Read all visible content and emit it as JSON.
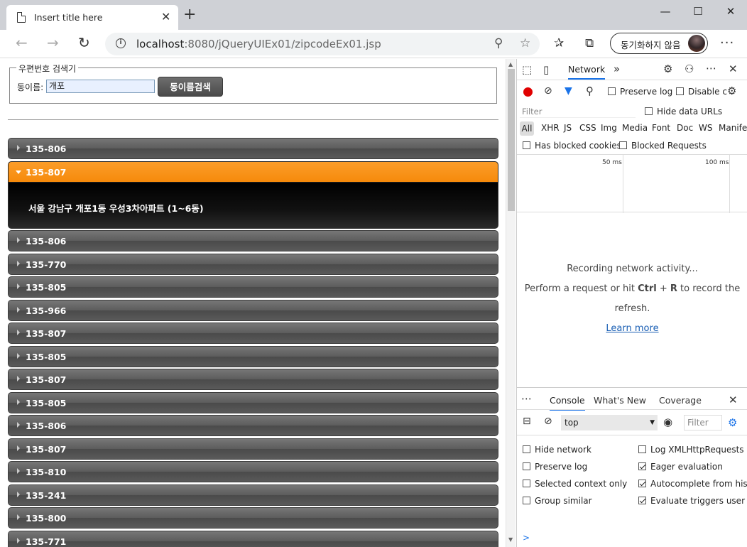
{
  "browser": {
    "tab_title": "Insert title here",
    "new_tab_symbol": "+",
    "url_host": "localhost",
    "url_path": ":8080/jQueryUIEx01/zipcodeEx01.jsp",
    "sync_label": "동기화하지 않음"
  },
  "form": {
    "legend": "우편번호 검색기",
    "dong_label": "동이름:",
    "dong_value": "개포",
    "search_button": "동이름검색"
  },
  "accordion": {
    "items": [
      {
        "code": "135-806"
      },
      {
        "code": "135-807",
        "content": "서울 강남구 개포1동 우성3차아파트 (1~6동)"
      },
      {
        "code": "135-806"
      },
      {
        "code": "135-770"
      },
      {
        "code": "135-805"
      },
      {
        "code": "135-966"
      },
      {
        "code": "135-807"
      },
      {
        "code": "135-805"
      },
      {
        "code": "135-807"
      },
      {
        "code": "135-805"
      },
      {
        "code": "135-806"
      },
      {
        "code": "135-807"
      },
      {
        "code": "135-810"
      },
      {
        "code": "135-241"
      },
      {
        "code": "135-800"
      },
      {
        "code": "135-771"
      }
    ]
  },
  "devtools": {
    "network_tab": "Network",
    "more_tabs": "»",
    "preserve_log": "Preserve log",
    "disable_cache": "Disable c",
    "filter_placeholder": "Filter",
    "hide_data_urls": "Hide data URLs",
    "types": [
      "All",
      "XHR",
      "JS",
      "CSS",
      "Img",
      "Media",
      "Font",
      "Doc",
      "WS",
      "Manifes"
    ],
    "has_blocked_cookies": "Has blocked cookies",
    "blocked_requests": "Blocked Requests",
    "timeline_labels": [
      "50 ms",
      "100 ms"
    ],
    "msg_recording": "Recording network activity...",
    "msg_perform_pre": "Perform a request or hit ",
    "msg_ctrl": "Ctrl",
    "msg_plus": " + ",
    "msg_r": "R",
    "msg_perform_post": " to record the",
    "msg_refresh": "refresh.",
    "learn_more": "Learn more"
  },
  "drawer": {
    "tabs": [
      "Console",
      "What's New",
      "Coverage"
    ],
    "context": "top",
    "filter_placeholder": "Filter",
    "options_left": [
      {
        "label": "Hide network",
        "checked": false
      },
      {
        "label": "Preserve log",
        "checked": false
      },
      {
        "label": "Selected context only",
        "checked": false
      },
      {
        "label": "Group similar",
        "checked": false
      }
    ],
    "options_right": [
      {
        "label": "Log XMLHttpRequests",
        "checked": false
      },
      {
        "label": "Eager evaluation",
        "checked": true
      },
      {
        "label": "Autocomplete from histor",
        "checked": true
      },
      {
        "label": "Evaluate triggers user acti",
        "checked": true
      }
    ],
    "prompt": ">"
  }
}
